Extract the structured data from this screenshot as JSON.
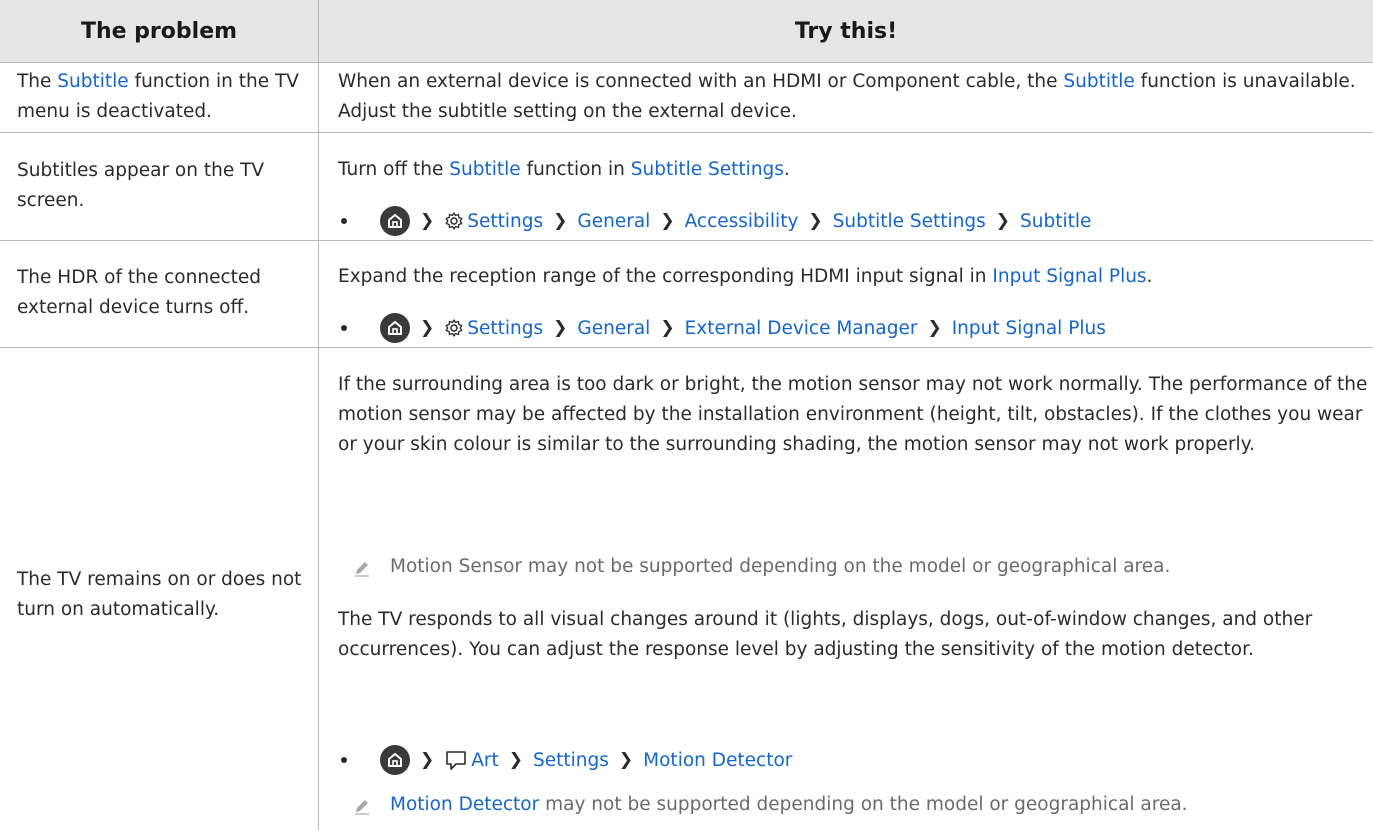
{
  "table": {
    "col_problem": "The problem",
    "col_try": "Try this!"
  },
  "rows": [
    {
      "problem_pre": "The ",
      "problem_link": "Subtitle",
      "problem_post": " function in the TV menu is deactivated.",
      "sol_pre": "When an external device is connected with an HDMI or Component cable, the ",
      "sol_link": "Subtitle",
      "sol_post": " function is unavailable. Adjust the subtitle setting on the external device."
    },
    {
      "problem": "Subtitles appear on the TV screen.",
      "sol_pre": "Turn off the ",
      "sol_link1": "Subtitle",
      "sol_mid": " function in ",
      "sol_link2": "Subtitle Settings",
      "sol_post": ".",
      "path": [
        "Settings",
        "General",
        "Accessibility",
        "Subtitle Settings",
        "Subtitle"
      ]
    },
    {
      "problem": "The HDR of the connected external device turns off.",
      "sol_pre": "Expand the reception range of the corresponding HDMI input signal in ",
      "sol_link": "Input Signal Plus",
      "sol_post": ".",
      "path": [
        "Settings",
        "General",
        "External Device Manager",
        "Input Signal Plus"
      ]
    },
    {
      "problem": "The TV remains on or does not turn on automatically.",
      "para1": "If the surrounding area is too dark or bright, the motion sensor may not work normally. The performance of the motion sensor may be affected by the installation environment (height, tilt, obstacles). If the clothes you wear or your skin colour is similar to the surrounding shading, the motion sensor may not work properly.",
      "note1": "Motion Sensor may not be supported depending on the model or geographical area.",
      "para2": "The TV responds to all visual changes around it (lights, displays, dogs, out-of-window changes, and other occurrences). You can adjust the response level by adjusting the sensitivity of the motion detector.",
      "path": [
        "Art",
        "Settings",
        "Motion Detector"
      ],
      "note2_link": "Motion Detector",
      "note2_post": " may not be supported depending on the model or geographical area."
    }
  ],
  "icons": {
    "home": "home-icon",
    "settings": "gear-icon",
    "art": "art-icon",
    "note": "pencil-icon",
    "separator": "chevron-right-icon"
  },
  "colors": {
    "link": "#1566c8",
    "header_bg": "#e6e6e6",
    "border": "#b9b9b9"
  }
}
